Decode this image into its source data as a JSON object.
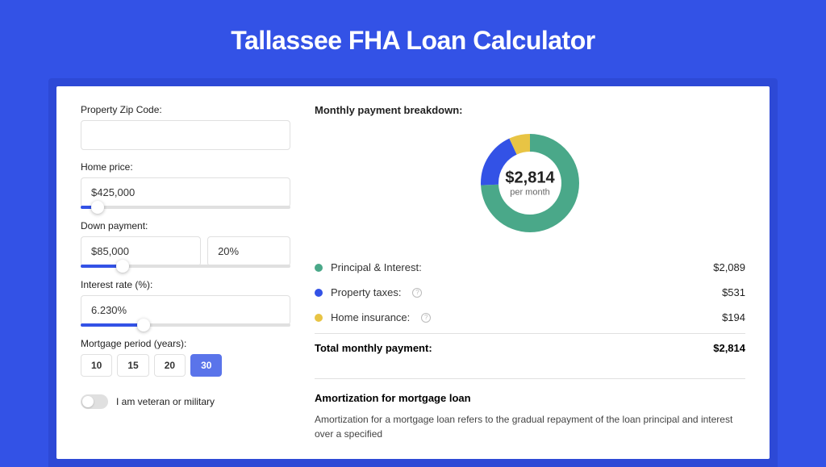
{
  "title": "Tallassee FHA Loan Calculator",
  "form": {
    "zip": {
      "label": "Property Zip Code:",
      "value": ""
    },
    "home_price": {
      "label": "Home price:",
      "value": "$425,000",
      "slider_pct": 8
    },
    "down_payment": {
      "label": "Down payment:",
      "amount": "$85,000",
      "percent": "20%",
      "slider_pct": 20
    },
    "interest": {
      "label": "Interest rate (%):",
      "value": "6.230%",
      "slider_pct": 30
    },
    "period": {
      "label": "Mortgage period (years):",
      "options": [
        "10",
        "15",
        "20",
        "30"
      ],
      "active": "30"
    },
    "veteran": {
      "label": "I am veteran or military"
    }
  },
  "breakdown": {
    "title": "Monthly payment breakdown:",
    "center_amount": "$2,814",
    "center_sub": "per month",
    "rows": [
      {
        "color": "green",
        "label": "Principal & Interest:",
        "info": false,
        "value": "$2,089"
      },
      {
        "color": "blue",
        "label": "Property taxes:",
        "info": true,
        "value": "$531"
      },
      {
        "color": "yellow",
        "label": "Home insurance:",
        "info": true,
        "value": "$194"
      }
    ],
    "total_label": "Total monthly payment:",
    "total_value": "$2,814"
  },
  "amortization": {
    "title": "Amortization for mortgage loan",
    "text": "Amortization for a mortgage loan refers to the gradual repayment of the loan principal and interest over a specified"
  },
  "chart_data": {
    "type": "pie",
    "title": "Monthly payment breakdown",
    "series": [
      {
        "name": "Principal & Interest",
        "value": 2089,
        "color": "#4aa889"
      },
      {
        "name": "Property taxes",
        "value": 531,
        "color": "#3352e6"
      },
      {
        "name": "Home insurance",
        "value": 194,
        "color": "#e8c444"
      }
    ],
    "total": 2814,
    "center_label": "$2,814 per month"
  }
}
